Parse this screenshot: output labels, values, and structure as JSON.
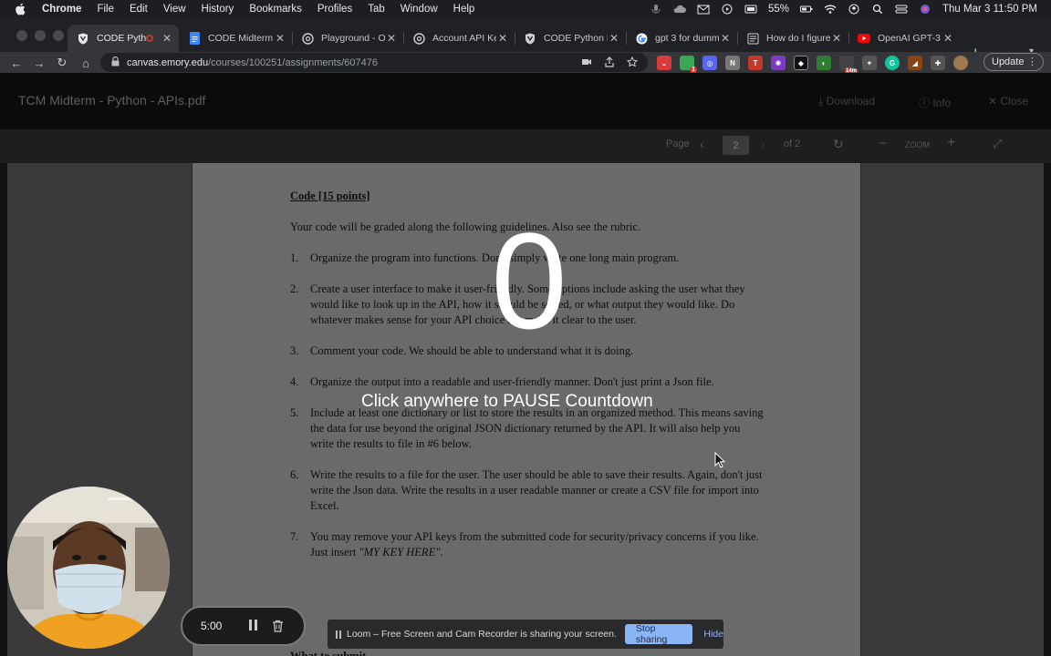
{
  "menubar": {
    "app": "Chrome",
    "items": [
      "File",
      "Edit",
      "View",
      "History",
      "Bookmarks",
      "Profiles",
      "Tab",
      "Window",
      "Help"
    ],
    "battery": "55%",
    "datetime": "Thu Mar 3  11:50 PM"
  },
  "tabs": [
    {
      "title": "CODE Pyth",
      "favicon": "shield-icon",
      "active": true,
      "recording": true
    },
    {
      "title": "CODE Midterm",
      "favicon": "docs-icon",
      "active": false
    },
    {
      "title": "Playground - O",
      "favicon": "openai-icon",
      "active": false
    },
    {
      "title": "Account API Ke",
      "favicon": "openai-icon",
      "active": false
    },
    {
      "title": "CODE Python M",
      "favicon": "shield-icon",
      "active": false
    },
    {
      "title": "gpt 3 for dumm",
      "favicon": "google-icon",
      "active": false
    },
    {
      "title": "How do I figure",
      "favicon": "page-icon",
      "active": false
    },
    {
      "title": "OpenAI GPT-3",
      "favicon": "youtube-icon",
      "active": false
    }
  ],
  "toolbar": {
    "url_host": "canvas.emory.edu",
    "url_path": "/courses/100251/assignments/607476",
    "update_label": "Update",
    "ext_badge_1": "1",
    "ext_badge_2": "14m"
  },
  "viewer": {
    "doc_title": "TCM Midterm - Python - APIs.pdf",
    "download": "Download",
    "info": "Info",
    "close": "Close",
    "page_label": "Page",
    "page_current": "2",
    "page_total": "of 2",
    "zoom_label": "ZOOM"
  },
  "pdf": {
    "heading": "Code [15 points]",
    "intro": "Your code will be graded along the following guidelines. Also see the rubric.",
    "items": [
      {
        "num": "1.",
        "text": "Organize the program into functions. Don't simply write one long main program."
      },
      {
        "num": "2.",
        "text": "Create a user interface to make it user-friendly. Some options include asking the user what they would like to look up in the API, how it should be sorted, or what output they would like. Do whatever makes sense for your API choice but make it clear to the user."
      },
      {
        "num": "3.",
        "text": "Comment your code. We should be able to understand what it is doing."
      },
      {
        "num": "4.",
        "text": "Organize the output into a readable and user-friendly manner. Don't just print a Json file."
      },
      {
        "num": "5.",
        "text": "Include at least one dictionary or list to store the results in an organized method. This means saving the data for use beyond the original JSON dictionary returned by the API. It will also help you write the results to file in #6 below."
      },
      {
        "num": "6.",
        "text": "Write the results to a file for the user.  The user should be able to save their results. Again, don't just write the Json data. Write the results in a user readable manner or create a CSV file for import into Excel."
      },
      {
        "num": "7.",
        "text": "You may remove your API keys from the submitted code for security/privacy concerns if you like.  Just insert ",
        "emph": "\"MY KEY HERE\"",
        "tail": "."
      }
    ],
    "footer_partial": "What to submit"
  },
  "overlay": {
    "countdown": "0",
    "message": "Click anywhere to PAUSE Countdown"
  },
  "recorder": {
    "time": "5:00"
  },
  "share_bar": {
    "message": "Loom – Free Screen and Cam Recorder is sharing your screen.",
    "stop": "Stop sharing",
    "hide": "Hide"
  }
}
